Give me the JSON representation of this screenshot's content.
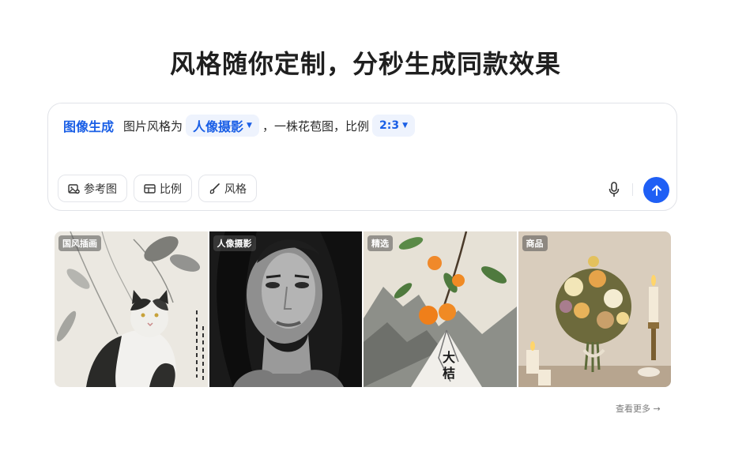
{
  "heading": "风格随你定制，分秒生成同款效果",
  "prompt": {
    "mode_label": "图像生成",
    "text_prefix": "图片风格为",
    "style_value": "人像摄影",
    "text_middle": "，一株花苞图，比例",
    "ratio_value": "2:3"
  },
  "tools": {
    "reference": "参考图",
    "ratio": "比例",
    "style": "风格"
  },
  "gallery": [
    {
      "tag": "国风插画"
    },
    {
      "tag": "人像摄影"
    },
    {
      "tag": "精选"
    },
    {
      "tag": "商品"
    }
  ],
  "see_more": "查看更多 →",
  "colors": {
    "accent": "#1f5ff5",
    "pill_bg": "#eef3fd",
    "border": "#e1e3e8"
  },
  "icons": [
    "image-plus-icon",
    "ratio-icon",
    "brush-icon",
    "microphone-icon",
    "arrow-up-icon",
    "chevron-down-icon"
  ]
}
